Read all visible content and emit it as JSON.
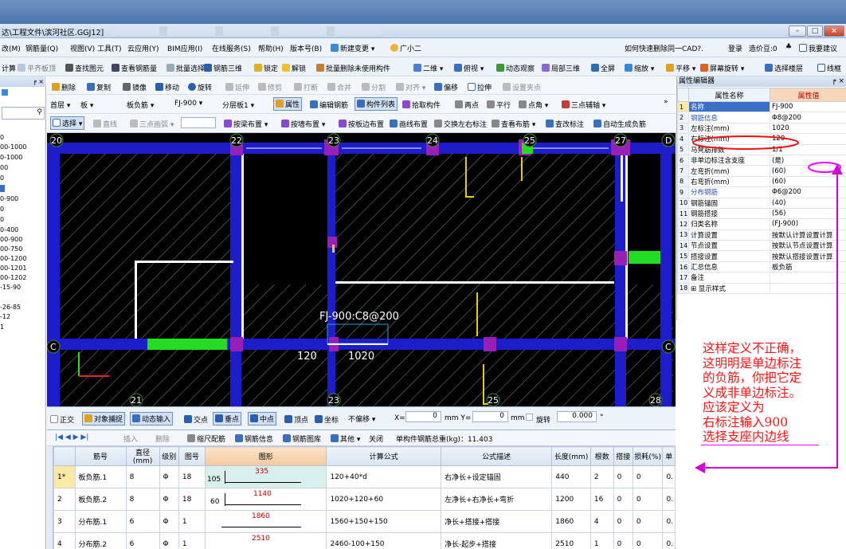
{
  "window": {
    "title": "达\\工程文件\\滨河社区.GGJ12]",
    "controls": [
      "–",
      "□",
      "×"
    ]
  },
  "menubar": {
    "items": [
      "改(M)",
      "钢筋量(Q)",
      "视图(V)",
      "工具(T)",
      "云应用(Y)",
      "BIM应用(I)",
      "在线服务(S)",
      "帮助(H)",
      "版本号(B)",
      "新建变更 ▾",
      "广小二"
    ],
    "ad_text": "如何快速删除同一CAD?.",
    "login": "登录",
    "bean": "造价豆:0",
    "suggest": "我要建议"
  },
  "toolbar1": {
    "items": [
      "计算",
      "平齐板顶",
      "查找图元",
      "查看钢筋量",
      "批量选择",
      "钢筋三维",
      "锁定",
      "解锁",
      "批量删除未使用构件",
      "二维 ▾",
      "俯视 ▾",
      "动态观察",
      "局部三维",
      "全屏",
      "缩放 ▾",
      "平移 ▾",
      "屏幕旋转 ▾",
      "选择楼层",
      "线框"
    ]
  },
  "left_panel": {
    "pin": "╒ ×",
    "items": [
      "0",
      "00-1000",
      "0-1000",
      "00",
      "0",
      "0-900",
      "0",
      "0",
      "0-400",
      "00-900",
      "00-750",
      "00-1200",
      "00-1201",
      "00-1202",
      "-15-90",
      "",
      "-26-85",
      "-12",
      "1"
    ]
  },
  "toolbar2": {
    "items": [
      "删除",
      "复制",
      "镜像",
      "移动",
      "旋转",
      "延伸",
      "修剪",
      "打断",
      "合并",
      "分割",
      "对齐 ▾",
      "偏移",
      "拉伸",
      "设置夹点"
    ]
  },
  "toolbar3": {
    "floor": "首层",
    "type": "板",
    "subtype": "板负筋",
    "component": "FJ-900",
    "layer": "分层板1",
    "buttons": [
      "属性",
      "编辑钢筋",
      "构件列表",
      "拾取构件",
      "两点",
      "平行",
      "点角 ▾",
      "三点辅轴 ▾"
    ],
    "more": "»"
  },
  "toolbar4": {
    "select": "选择",
    "items": [
      "直线",
      "三点画弧 ▾",
      "按梁布置 ▾",
      "按墙布置 ▾",
      "按板边布置",
      "画线布置",
      "交换左右标注",
      "查看布筋 ▾",
      "查改标注",
      "自动生成负筋"
    ]
  },
  "canvas": {
    "axis_top": [
      "20",
      "22",
      "23",
      "24",
      "25",
      "27",
      "D"
    ],
    "axis_bottom": [
      "21",
      "23",
      "25",
      "28"
    ],
    "axis_left": "C",
    "axis_right": "C",
    "rebar_label": "FJ-900:C8@200",
    "dim_left": "120",
    "dim_right": "1020",
    "colors": {
      "background": "#000000",
      "beam": "#1d1dcc",
      "wall_white": "#ffffff",
      "column": "#9a1fb8",
      "highlight": "#22dd22",
      "rebar_yellow": "#e8d000",
      "axis": "#3a8a3a"
    }
  },
  "snapbar": {
    "items": [
      "正交",
      "对象捕捉",
      "动态输入",
      "交点",
      "垂点",
      "中点",
      "顶点",
      "坐标"
    ],
    "offset_mode": "不偏移 ▾",
    "x_label": "X=",
    "x_value": "0",
    "y_label": "mm  Y=",
    "y_value": "0",
    "mm": "mm",
    "rotate_label": "旋转",
    "rotate_value": "0.000",
    "degree": "°"
  },
  "table_toolbar": {
    "nav": "|◀  ◀  ▶  ▶|",
    "items": [
      "插入",
      "删除",
      "缩尺配筋",
      "钢筋信息",
      "钢筋图库",
      "其他 ▾",
      "关闭"
    ],
    "total": "单构件钢筋总重(kg)：11.403"
  },
  "rebar_table": {
    "columns": [
      "筋号",
      "直径(mm)",
      "级别",
      "图号",
      "图形",
      "计算公式",
      "公式描述",
      "长度(mm)",
      "根数",
      "搭接",
      "损耗(%)",
      "单"
    ],
    "rows": [
      {
        "idx": "1*",
        "name": "板负筋.1",
        "dia": "8",
        "grade": "Φ",
        "fig": "18",
        "shape_left": "105",
        "shape_val": "335",
        "formula": "120+40*d",
        "desc": "右净长+设定锚固",
        "len": "440",
        "count": "2",
        "lap": "0",
        "loss": "0",
        "unit": "0."
      },
      {
        "idx": "2",
        "name": "板负筋.2",
        "dia": "8",
        "grade": "Φ",
        "fig": "18",
        "shape_left": "60",
        "shape_val": "1140",
        "formula": "1020+120+60",
        "desc": "左净长+右净长+弯折",
        "len": "1200",
        "count": "16",
        "lap": "0",
        "loss": "0",
        "unit": "0."
      },
      {
        "idx": "3",
        "name": "分布筋.1",
        "dia": "6",
        "grade": "Φ",
        "fig": "1",
        "shape_left": "",
        "shape_val": "1860",
        "formula": "1560+150+150",
        "desc": "净长+搭接+搭接",
        "len": "1860",
        "count": "4",
        "lap": "0",
        "loss": "0",
        "unit": "0."
      },
      {
        "idx": "4",
        "name": "分布筋.2",
        "dia": "6",
        "grade": "Φ",
        "fig": "1",
        "shape_left": "",
        "shape_val": "2510",
        "formula": "2460-100+150",
        "desc": "净长-起步+搭接",
        "len": "2510",
        "count": "1",
        "lap": "0",
        "loss": "0",
        "unit": "0."
      }
    ]
  },
  "property_panel": {
    "title": "属性编辑器",
    "pin": "╒ ×",
    "col_name": "属性名称",
    "col_value": "属性值",
    "rows": [
      {
        "n": "1",
        "name": "名称",
        "value": "FJ-900",
        "blue": false
      },
      {
        "n": "2",
        "name": "钢筋信息",
        "value": "Φ8@200",
        "blue": true
      },
      {
        "n": "3",
        "name": "左标注(mm)",
        "value": "1020",
        "blue": false
      },
      {
        "n": "4",
        "name": "右标注(mm)",
        "value": "120",
        "blue": false
      },
      {
        "n": "5",
        "name": "马凳筋排数",
        "value": "1/1",
        "blue": false
      },
      {
        "n": "6",
        "name": "非单边标注含支座",
        "value": "(是)",
        "blue": false
      },
      {
        "n": "7",
        "name": "左弯折(mm)",
        "value": "(60)",
        "blue": false
      },
      {
        "n": "8",
        "name": "右弯折(mm)",
        "value": "(60)",
        "blue": false
      },
      {
        "n": "9",
        "name": "分布钢筋",
        "value": "Φ6@200",
        "blue": true
      },
      {
        "n": "10",
        "name": "钢筋锚固",
        "value": "(40)",
        "blue": false
      },
      {
        "n": "11",
        "name": "钢筋搭接",
        "value": "(56)",
        "blue": false
      },
      {
        "n": "12",
        "name": "归类名称",
        "value": "(FJ-900)",
        "blue": false
      },
      {
        "n": "13",
        "name": "计算设置",
        "value": "按默认计算设置计算",
        "blue": false
      },
      {
        "n": "14",
        "name": "节点设置",
        "value": "按默认节点设置计算",
        "blue": false
      },
      {
        "n": "15",
        "name": "搭接设置",
        "value": "按默认搭接设置计算",
        "blue": false
      },
      {
        "n": "16",
        "name": "汇总信息",
        "value": "板负筋",
        "blue": false
      },
      {
        "n": "17",
        "name": "备注",
        "value": "",
        "blue": false
      },
      {
        "n": "18",
        "name": "⊞ 显示样式",
        "value": "",
        "blue": false
      }
    ]
  },
  "annotation": {
    "text": "这样定义不正确，\n这明明是单边标注\n的负筋，你把它定\n义成非单边标注。\n应该定义为\n右标注输入900\n选择支座内边线",
    "color": "#ff1313",
    "mark_color": "#d400d4"
  }
}
